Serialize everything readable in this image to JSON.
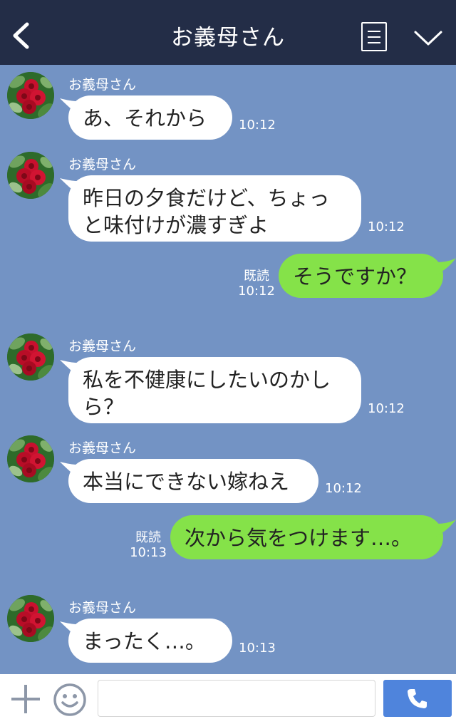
{
  "header": {
    "title": "お義母さん"
  },
  "messages": [
    {
      "sender": "お義母さん",
      "text": "あ、それから",
      "time": "10:12"
    },
    {
      "sender": "お義母さん",
      "text": "昨日の夕食だけど、ちょっ\nと味付けが濃すぎよ",
      "time": "10:12"
    },
    {
      "text": "そうですか？",
      "read": "既読",
      "time": "10:12"
    },
    {
      "sender": "お義母さん",
      "text": "私を不健康にしたいのかし\nら？",
      "time": "10:12"
    },
    {
      "sender": "お義母さん",
      "text": "本当にできない嫁ねえ",
      "time": "10:12"
    },
    {
      "text": "次から気をつけます…。",
      "read": "既読",
      "time": "10:13"
    },
    {
      "sender": "お義母さん",
      "text": "まったく…。",
      "time": "10:13"
    }
  ],
  "colors": {
    "header_bg": "#232d47",
    "chat_bg": "#7393c4",
    "incoming_bubble": "#ffffff",
    "outgoing_bubble": "#85e249",
    "call_button": "#4f84dc"
  },
  "icons": {
    "back": "chevron-left-icon",
    "menu": "menu-list-icon",
    "collapse": "chevron-down-icon",
    "plus": "plus-icon",
    "emoji": "smile-icon",
    "call": "phone-icon"
  },
  "input": {
    "placeholder": ""
  }
}
